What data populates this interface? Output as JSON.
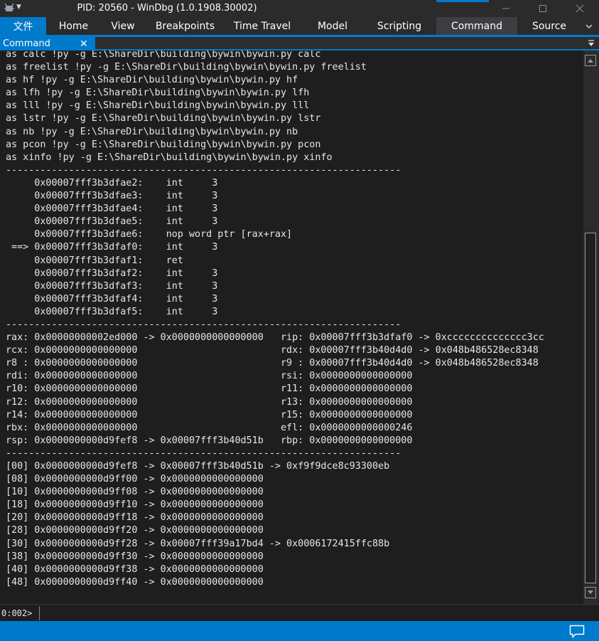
{
  "window": {
    "title": "PID: 20560 - WinDbg (1.0.1908.30002)",
    "app_icon": "windbg-icon",
    "controls": [
      "minimize-icon",
      "maximize-icon",
      "close-icon"
    ]
  },
  "ribbon": {
    "file_label": "文件",
    "tabs": [
      "Home",
      "View",
      "Breakpoints",
      "Time Travel",
      "Model",
      "Scripting",
      "Command",
      "Source"
    ],
    "active_tab": "Command",
    "overflow_icon": "chevron-down-icon"
  },
  "doc_tab": {
    "label": "Command",
    "close_glyph": "✕"
  },
  "output": {
    "lines": [
      "as calc !py -g E:\\ShareDir\\building\\bywin\\bywin.py calc",
      "as freelist !py -g E:\\ShareDir\\building\\bywin\\bywin.py freelist",
      "as hf !py -g E:\\ShareDir\\building\\bywin\\bywin.py hf",
      "as lfh !py -g E:\\ShareDir\\building\\bywin\\bywin.py lfh",
      "as lll !py -g E:\\ShareDir\\building\\bywin\\bywin.py lll",
      "as lstr !py -g E:\\ShareDir\\building\\bywin\\bywin.py lstr",
      "as nb !py -g E:\\ShareDir\\building\\bywin\\bywin.py nb",
      "as pcon !py -g E:\\ShareDir\\building\\bywin\\bywin.py pcon",
      "as xinfo !py -g E:\\ShareDir\\building\\bywin\\bywin.py xinfo",
      "---------------------------------------------------------------------",
      "     0x00007fff3b3dfae2:    int     3",
      "     0x00007fff3b3dfae3:    int     3",
      "     0x00007fff3b3dfae4:    int     3",
      "     0x00007fff3b3dfae5:    int     3",
      "     0x00007fff3b3dfae6:    nop word ptr [rax+rax]",
      " ==> 0x00007fff3b3dfaf0:    int     3",
      "     0x00007fff3b3dfaf1:    ret",
      "     0x00007fff3b3dfaf2:    int     3",
      "     0x00007fff3b3dfaf3:    int     3",
      "     0x00007fff3b3dfaf4:    int     3",
      "     0x00007fff3b3dfaf5:    int     3",
      "---------------------------------------------------------------------",
      "rax: 0x00000000002ed000 -> 0x0000000000000000   rip: 0x00007fff3b3dfaf0 -> 0xcccccccccccccc3cc",
      "rcx: 0x0000000000000000                         rdx: 0x00007fff3b40d4d0 -> 0x048b486528ec8348",
      "r8 : 0x0000000000000000                         r9 : 0x00007fff3b40d4d0 -> 0x048b486528ec8348",
      "rdi: 0x0000000000000000                         rsi: 0x0000000000000000",
      "r10: 0x0000000000000000                         r11: 0x0000000000000000",
      "r12: 0x0000000000000000                         r13: 0x0000000000000000",
      "r14: 0x0000000000000000                         r15: 0x0000000000000000",
      "rbx: 0x0000000000000000                         efl: 0x0000000000000246",
      "rsp: 0x0000000000d9fef8 -> 0x00007fff3b40d51b   rbp: 0x0000000000000000",
      "---------------------------------------------------------------------",
      "[00] 0x0000000000d9fef8 -> 0x00007fff3b40d51b -> 0xf9f9dce8c93300eb",
      "[08] 0x0000000000d9ff00 -> 0x0000000000000000",
      "[10] 0x0000000000d9ff08 -> 0x0000000000000000",
      "[18] 0x0000000000d9ff10 -> 0x0000000000000000",
      "[20] 0x0000000000d9ff18 -> 0x0000000000000000",
      "[28] 0x0000000000d9ff20 -> 0x0000000000000000",
      "[30] 0x0000000000d9ff28 -> 0x00007fff39a17bd4 -> 0x0006172415ffc88b",
      "[38] 0x0000000000d9ff30 -> 0x0000000000000000",
      "[40] 0x0000000000d9ff38 -> 0x0000000000000000",
      "[48] 0x0000000000d9ff40 -> 0x0000000000000000"
    ]
  },
  "command": {
    "prompt": "0:002>",
    "value": "",
    "placeholder": ""
  },
  "statusbar": {
    "notification_icon": "chat-bubble-icon"
  },
  "colors": {
    "accent": "#007acc",
    "background": "#1e1e1e",
    "chrome": "#2b2b2b",
    "text": "#e6e6e6"
  }
}
